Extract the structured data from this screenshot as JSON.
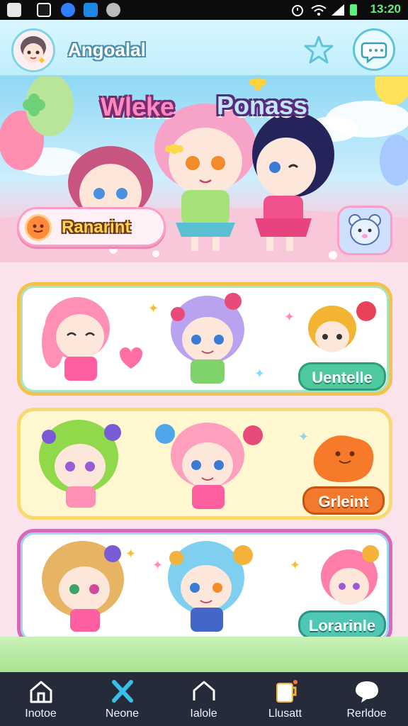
{
  "status_bar": {
    "time": "13:20"
  },
  "header": {
    "username": "Angoalal",
    "star_icon": "star-icon",
    "chat_icon": "chat-bubble-icon"
  },
  "hero": {
    "title_left": "Wleke",
    "title_right": "Ponass",
    "rank_label": "Ranarint",
    "pet_icon": "bear-icon"
  },
  "cards": [
    {
      "button_label": "Uentelle",
      "button_color": "#4fc9a0",
      "border_color": "#f2c24a"
    },
    {
      "button_label": "Grleint",
      "button_color": "#f37a2c",
      "border_color": "#f8d96f"
    },
    {
      "button_label": "Lorarinle",
      "button_color": "#4ec7b4",
      "border_color": "#d868b9"
    }
  ],
  "bottom_nav": [
    {
      "label": "Inotoe",
      "icon": "home-icon"
    },
    {
      "label": "Neone",
      "icon": "cross-icon"
    },
    {
      "label": "Ialole",
      "icon": "house-outline-icon"
    },
    {
      "label": "Llusatt",
      "icon": "cup-icon"
    },
    {
      "label": "Rerldoe",
      "icon": "bubble-icon"
    }
  ]
}
